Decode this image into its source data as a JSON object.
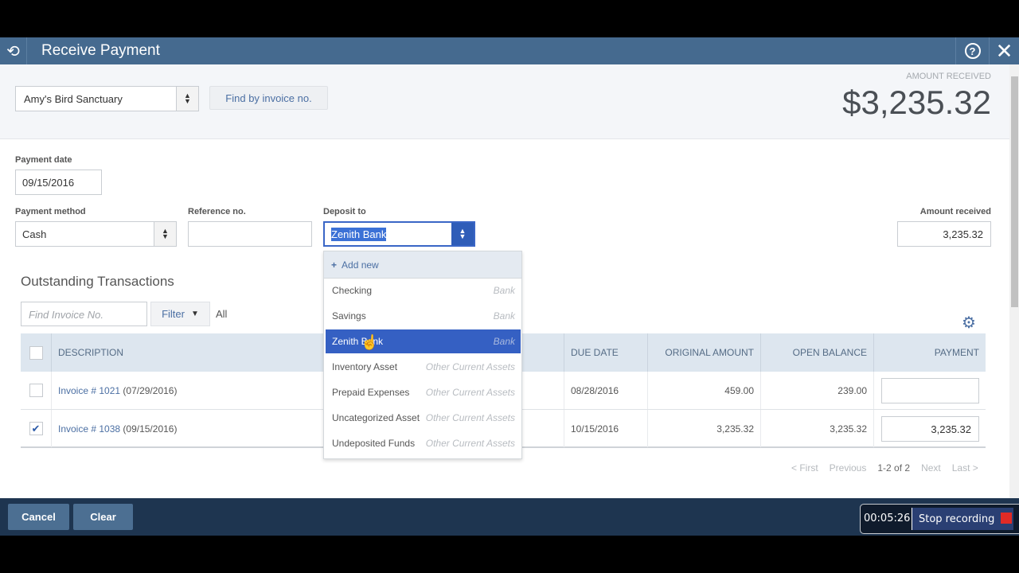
{
  "window": {
    "title": "Receive Payment",
    "icons": {
      "logo": "history-icon",
      "help": "help-icon",
      "close": "close-icon"
    }
  },
  "header": {
    "customer": "Amy's Bird Sanctuary",
    "find_by_invoice_label": "Find by invoice no.",
    "amount_received_label": "AMOUNT RECEIVED",
    "amount_received_value": "$3,235.32"
  },
  "form": {
    "payment_date_label": "Payment date",
    "payment_date_value": "09/15/2016",
    "payment_method_label": "Payment method",
    "payment_method_value": "Cash",
    "reference_label": "Reference no.",
    "reference_value": "",
    "deposit_to_label": "Deposit to",
    "deposit_to_value": "Zenith Bank",
    "amount_received_label": "Amount received",
    "amount_received_value": "3,235.32"
  },
  "deposit_dropdown": {
    "add_new_label": "Add new",
    "items": [
      {
        "name": "Checking",
        "type": "Bank",
        "selected": false
      },
      {
        "name": "Savings",
        "type": "Bank",
        "selected": false
      },
      {
        "name": "Zenith Bank",
        "type": "Bank",
        "selected": true
      },
      {
        "name": "Inventory Asset",
        "type": "Other Current Assets",
        "selected": false
      },
      {
        "name": "Prepaid Expenses",
        "type": "Other Current Assets",
        "selected": false
      },
      {
        "name": "Uncategorized Asset",
        "type": "Other Current Assets",
        "selected": false
      },
      {
        "name": "Undeposited Funds",
        "type": "Other Current Assets",
        "selected": false
      }
    ]
  },
  "outstanding": {
    "title": "Outstanding Transactions",
    "find_placeholder": "Find Invoice No.",
    "filter_label": "Filter",
    "filter_value": "All",
    "columns": [
      "DESCRIPTION",
      "DUE DATE",
      "ORIGINAL AMOUNT",
      "OPEN BALANCE",
      "PAYMENT"
    ],
    "rows": [
      {
        "checked": false,
        "invoice": "Invoice # 1021",
        "date": "(07/29/2016)",
        "due_date": "08/28/2016",
        "original_amount": "459.00",
        "open_balance": "239.00",
        "payment": ""
      },
      {
        "checked": true,
        "invoice": "Invoice # 1038",
        "date": "(09/15/2016)",
        "due_date": "10/15/2016",
        "original_amount": "3,235.32",
        "open_balance": "3,235.32",
        "payment": "3,235.32"
      }
    ],
    "pager": {
      "first": "< First",
      "previous": "Previous",
      "range": "1-2 of 2",
      "next": "Next",
      "last": "Last >"
    }
  },
  "footer": {
    "cancel_label": "Cancel",
    "clear_label": "Clear"
  },
  "recorder": {
    "time": "00:05:26",
    "stop_label": "Stop recording"
  }
}
